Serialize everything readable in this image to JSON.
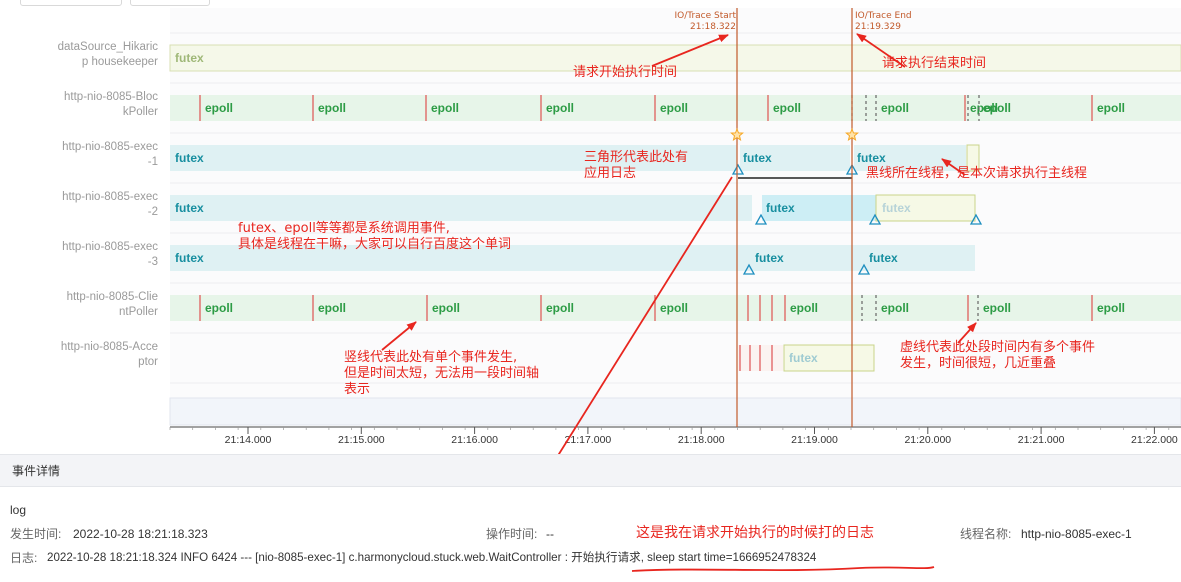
{
  "threads": [
    {
      "label_lines": [
        "dataSource_Hikaric",
        "p housekeeper"
      ]
    },
    {
      "label_lines": [
        "http-nio-8085-Bloc",
        "kPoller"
      ]
    },
    {
      "label_lines": [
        "http-nio-8085-exec",
        "-1"
      ]
    },
    {
      "label_lines": [
        "http-nio-8085-exec",
        "-2"
      ]
    },
    {
      "label_lines": [
        "http-nio-8085-exec",
        "-3"
      ]
    },
    {
      "label_lines": [
        "http-nio-8085-Clie",
        "ntPoller"
      ]
    },
    {
      "label_lines": [
        "http-nio-8085-Acce",
        "ptor"
      ]
    }
  ],
  "event_labels": {
    "futex": "futex",
    "epoll": "epoll"
  },
  "markers": {
    "start_title": "IO/Trace Start",
    "start_time": "21:18.322",
    "end_title": "IO/Trace End",
    "end_time": "21:19.329"
  },
  "axis": {
    "ticks": [
      "21:14.000",
      "21:15.000",
      "21:16.000",
      "21:17.000",
      "21:18.000",
      "21:19.000",
      "21:20.000",
      "21:21.000",
      "21:22.000"
    ]
  },
  "annotations": {
    "start": "请求开始执行时间",
    "end": "请求执行结束时间",
    "triangle": [
      "三角形代表此处有",
      "应用日志"
    ],
    "black_line": "黑线所在线程，是本次请求执行主线程",
    "syscall": [
      "futex、epoll等等都是系统调用事件,",
      "具体是线程在干嘛，大家可以自行百度这个单词"
    ],
    "vertical": [
      "竖线代表此处有单个事件发生,",
      "但是时间太短，无法用一段时间轴",
      "表示"
    ],
    "dashed": [
      "虚线代表此处段时间内有多个事件",
      "发生，时间很短，几近重叠"
    ],
    "log_note": "这是我在请求开始执行的时候打的日志"
  },
  "details": {
    "header": "事件详情",
    "event_type": "log",
    "occur_label": "发生时间:",
    "occur_value": "2022-10-28 18:21:18.323",
    "op_label": "操作时间:",
    "op_value": "--",
    "thread_label": "线程名称:",
    "thread_value": "http-nio-8085-exec-1",
    "log_label": "日志:",
    "log_value": "2022-10-28 18:21:18.324 INFO 6424 --- [nio-8085-exec-1] c.harmonycloud.stuck.web.WaitController : 开始执行请求, sleep start time=1666952478324"
  },
  "colors": {
    "futex": "#188fa0",
    "epoll": "#2c9c45",
    "annotation": "#e8261f",
    "marker": "#c25a2b",
    "triangle": "#1f8fc0",
    "star": "#f5a623"
  }
}
